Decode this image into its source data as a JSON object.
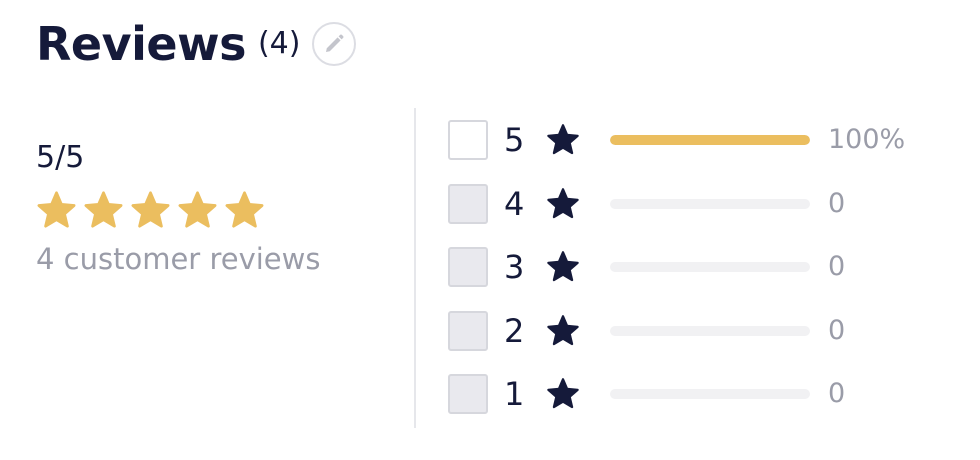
{
  "header": {
    "title": "Reviews",
    "count": "(4)",
    "edit_icon": "pencil-icon"
  },
  "summary": {
    "score": "5/5",
    "rating": 5,
    "max_rating": 5,
    "review_count": "4 customer reviews"
  },
  "colors": {
    "star_filled": "#ebbe5f",
    "star_dark": "#151a3a",
    "bar_fill": "#ebbe5f",
    "bar_track": "#f1f1f3",
    "muted_text": "#9a9ca8",
    "primary_text": "#151a3a"
  },
  "breakdown": [
    {
      "stars": "5",
      "share": 1.0,
      "label": "100%",
      "checked": false
    },
    {
      "stars": "4",
      "share": 0.0,
      "label": "0",
      "checked": false
    },
    {
      "stars": "3",
      "share": 0.0,
      "label": "0",
      "checked": false
    },
    {
      "stars": "2",
      "share": 0.0,
      "label": "0",
      "checked": false
    },
    {
      "stars": "1",
      "share": 0.0,
      "label": "0",
      "checked": false
    }
  ]
}
